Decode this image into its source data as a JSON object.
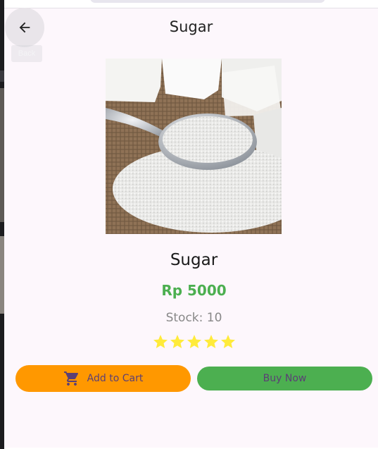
{
  "header": {
    "title": "Sugar",
    "back_tooltip": "Back",
    "back_icon": "arrow-back-icon"
  },
  "product": {
    "name": "Sugar",
    "price": "Rp 5000",
    "stock": "Stock: 10",
    "rating": 5,
    "rating_max": 5,
    "image": "sugar-spoon-image"
  },
  "actions": {
    "add_to_cart": "Add to Cart",
    "buy_now": "Buy Now",
    "cart_icon": "shopping-cart-icon"
  },
  "colors": {
    "price": "#4caf50",
    "add_to_cart_bg": "#ff9800",
    "buy_now_bg": "#4caf50",
    "star": "#ffeb3b",
    "button_text": "#5b3f75",
    "sheet_bg": "#fdf7fc"
  }
}
